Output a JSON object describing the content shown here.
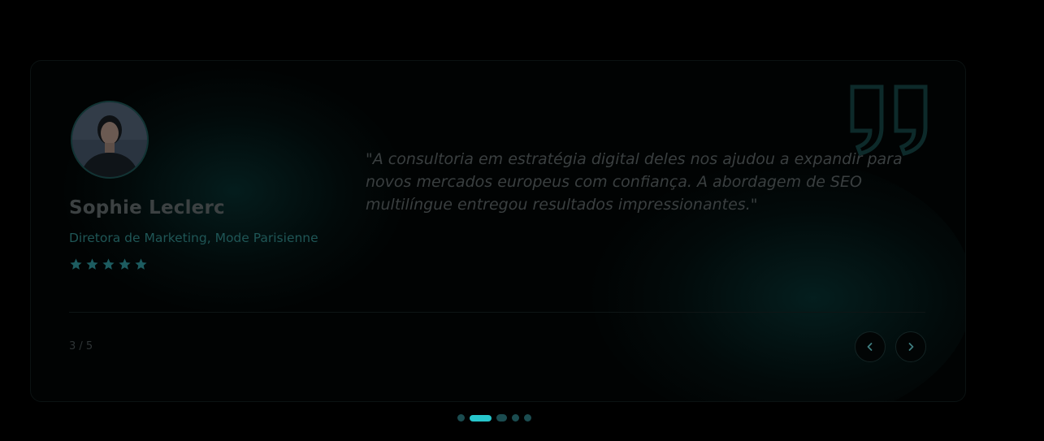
{
  "testimonial": {
    "name": "Sophie Leclerc",
    "role": "Diretora de Marketing, Mode Parisienne",
    "rating": 5,
    "rating_max": 5,
    "quote": "\"A consultoria em estratégia digital deles nos ajudou a expandir para novos mercados europeus com confiança. A abordagem de SEO multilíngue entregou resultados impressionantes.\""
  },
  "slider": {
    "counter": "3 / 5",
    "prev_icon": "chevron-left-icon",
    "next_icon": "chevron-right-icon",
    "dots": [
      {
        "state": "inactive"
      },
      {
        "state": "active"
      },
      {
        "state": "inactive-wide"
      },
      {
        "state": "inactive"
      },
      {
        "state": "inactive"
      }
    ]
  },
  "icons": {
    "quote": "quote-icon",
    "star": "star-icon",
    "avatar": "avatar-photo"
  },
  "colors": {
    "background": "#000000",
    "accent": "#27c6cc",
    "accent_dim": "#1b4c50",
    "name_text": "#3c4142",
    "role_text": "#1f5656",
    "star": "#1d5c60"
  }
}
